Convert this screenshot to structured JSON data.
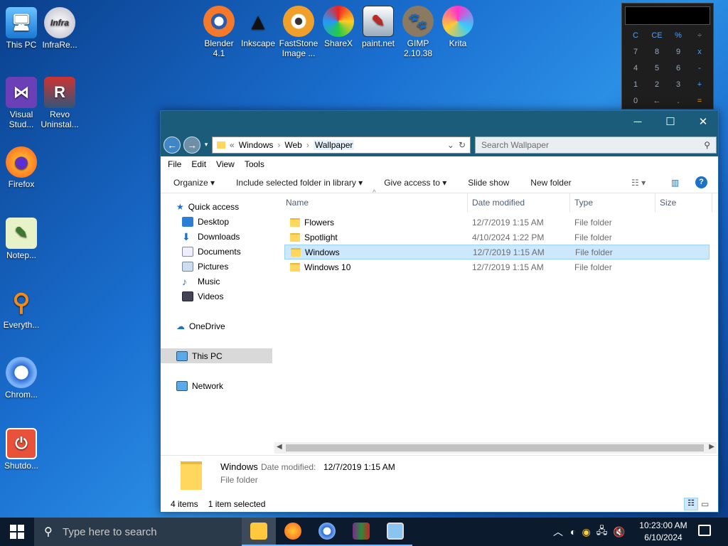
{
  "desktop": {
    "left_icons": [
      {
        "label": "This PC"
      },
      {
        "label": "InfraRe..."
      },
      {
        "label": "Visual Stud..."
      },
      {
        "label": "Revo Uninstal..."
      },
      {
        "label": "Firefox"
      },
      {
        "label": "Notep..."
      },
      {
        "label": "Everyth..."
      },
      {
        "label": "Chrom..."
      },
      {
        "label": "Shutdo..."
      }
    ],
    "top_icons": [
      {
        "label": "Blender 4.1"
      },
      {
        "label": "Inkscape"
      },
      {
        "label": "FastStone Image ..."
      },
      {
        "label": "ShareX"
      },
      {
        "label": "paint.net"
      },
      {
        "label": "GIMP 2.10.38"
      },
      {
        "label": "Krita"
      }
    ]
  },
  "calculator": {
    "keys": [
      "C",
      "CE",
      "%",
      "÷",
      "7",
      "8",
      "9",
      "x",
      "4",
      "5",
      "6",
      "-",
      "1",
      "2",
      "3",
      "+",
      "0",
      "←",
      ".",
      "="
    ]
  },
  "explorer": {
    "address": {
      "prefix": "«",
      "crumbs": [
        "Windows",
        "Web",
        "Wallpaper"
      ]
    },
    "search_placeholder": "Search Wallpaper",
    "menu": [
      "File",
      "Edit",
      "View",
      "Tools"
    ],
    "toolbar": {
      "organize": "Organize ▾",
      "include": "Include selected folder in library ▾",
      "give_access": "Give access to ▾",
      "slide_show": "Slide show",
      "new_folder": "New folder"
    },
    "nav": {
      "quick_access": "Quick access",
      "quick_items": [
        "Desktop",
        "Downloads",
        "Documents",
        "Pictures",
        "Music",
        "Videos"
      ],
      "onedrive": "OneDrive",
      "this_pc": "This PC",
      "network": "Network"
    },
    "columns": {
      "name": "Name",
      "date": "Date modified",
      "type": "Type",
      "size": "Size"
    },
    "rows": [
      {
        "name": "Flowers",
        "date": "12/7/2019 1:15 AM",
        "type": "File folder"
      },
      {
        "name": "Spotlight",
        "date": "4/10/2024 1:22 PM",
        "type": "File folder"
      },
      {
        "name": "Windows",
        "date": "12/7/2019 1:15 AM",
        "type": "File folder"
      },
      {
        "name": "Windows 10",
        "date": "12/7/2019 1:15 AM",
        "type": "File folder"
      }
    ],
    "details": {
      "name": "Windows",
      "date_label": "Date modified:",
      "date_value": "12/7/2019 1:15 AM",
      "kind": "File folder"
    },
    "status": {
      "items": "4 items",
      "selected": "1 item selected"
    }
  },
  "taskbar": {
    "search_placeholder": "Type here to search",
    "time": "10:23:00 AM",
    "date": "6/10/2024"
  }
}
